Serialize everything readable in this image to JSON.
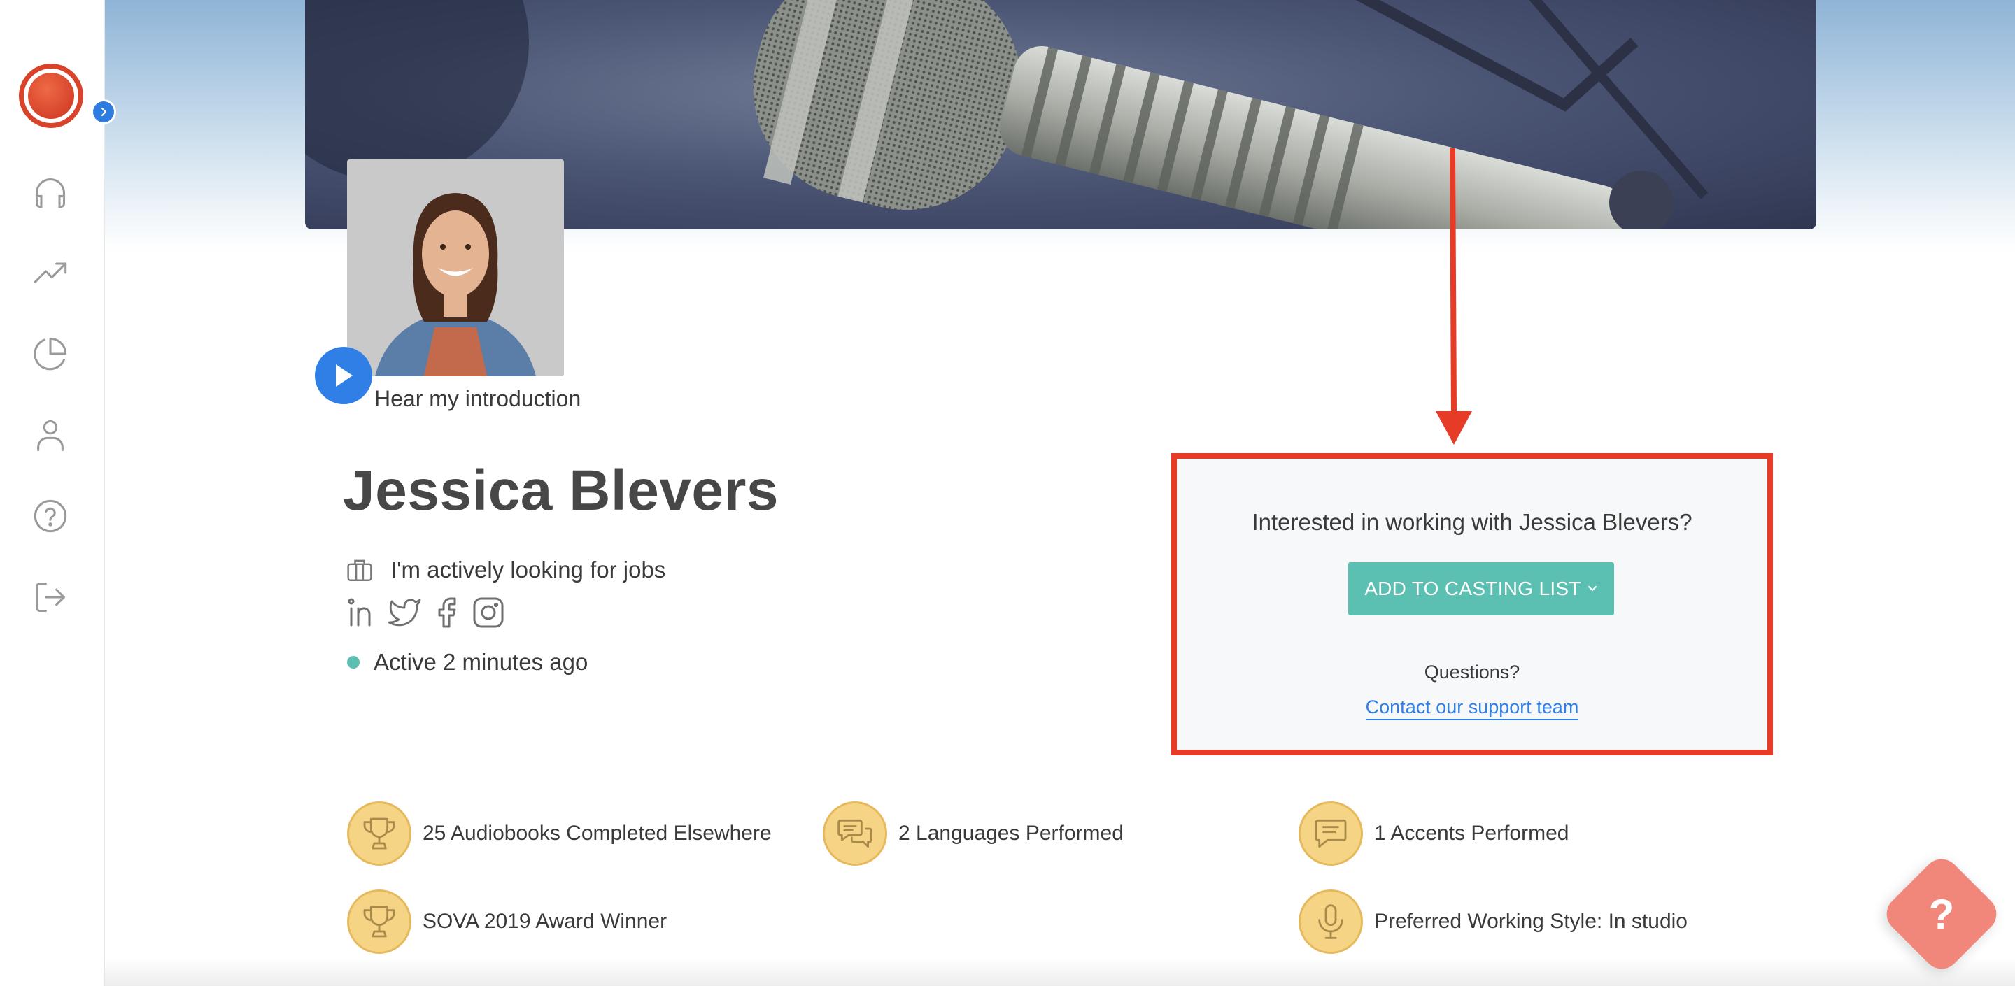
{
  "sidebar": {
    "items": [
      {
        "icon": "headphones-icon"
      },
      {
        "icon": "trending-up-icon"
      },
      {
        "icon": "pie-chart-icon"
      },
      {
        "icon": "user-icon"
      },
      {
        "icon": "help-circle-icon"
      },
      {
        "icon": "logout-icon"
      }
    ]
  },
  "profile": {
    "intro_label": "Hear my introduction",
    "name": "Jessica Blevers",
    "job_status": "I'm actively looking for jobs",
    "activity": "Active 2 minutes ago",
    "socials": [
      "linkedin-icon",
      "twitter-icon",
      "facebook-icon",
      "instagram-icon"
    ]
  },
  "casting": {
    "title": "Interested in working with Jessica Blevers?",
    "button_label": "ADD TO CASTING LIST",
    "questions": "Questions?",
    "support_link": "Contact our support team"
  },
  "achievements": [
    {
      "label": "25 Audiobooks Completed Elsewhere",
      "icon": "trophy-icon"
    },
    {
      "label": "2 Languages Performed",
      "icon": "chat-bubbles-icon"
    },
    {
      "label": "1 Accents Performed",
      "icon": "speech-bubble-icon"
    },
    {
      "label": "SOVA 2019 Award Winner",
      "icon": "trophy-icon"
    },
    {
      "label": "Preferred Working Style: In studio",
      "icon": "microphone-icon"
    }
  ],
  "help_button": "?",
  "colors": {
    "accent": "#5bbfb1",
    "link": "#2f7fe6",
    "highlight": "#e63b26",
    "brand": "#d7432a"
  }
}
